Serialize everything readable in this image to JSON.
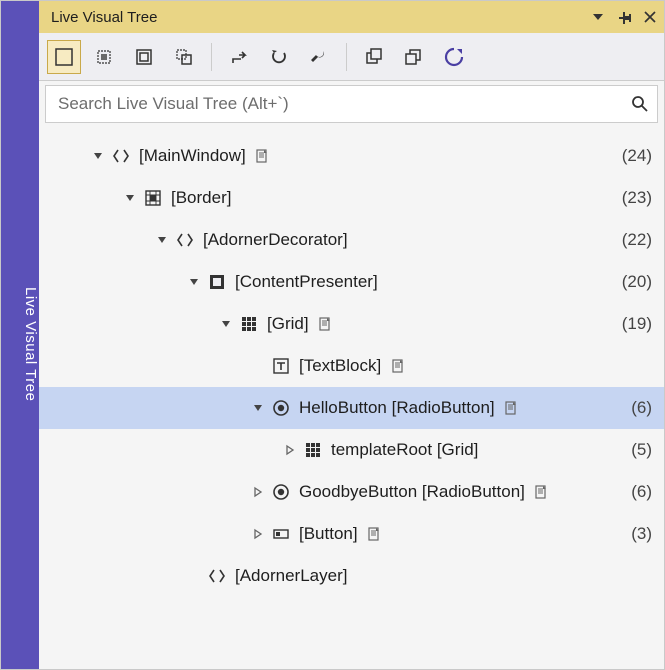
{
  "sideTab": {
    "label": "Live Visual Tree"
  },
  "header": {
    "title": "Live Visual Tree"
  },
  "toolbar": {
    "buttons": [
      {
        "name": "enable-selection",
        "active": true
      },
      {
        "name": "display-layout-adorners",
        "active": false
      },
      {
        "name": "preview-selection",
        "active": false
      },
      {
        "name": "track-focused",
        "active": false
      }
    ],
    "group2": [
      {
        "name": "go-to-live-property"
      },
      {
        "name": "undo-changes"
      },
      {
        "name": "settings"
      }
    ],
    "group3": [
      {
        "name": "collapse-all"
      },
      {
        "name": "expand-all"
      },
      {
        "name": "refresh"
      }
    ]
  },
  "search": {
    "placeholder": "Search Live Visual Tree (Alt+`)",
    "value": ""
  },
  "tree": [
    {
      "depth": 0,
      "arrow": "expanded",
      "icon": "element",
      "label": "[MainWindow]",
      "source": true,
      "count": "(24)",
      "selected": false,
      "interactable": true
    },
    {
      "depth": 1,
      "arrow": "expanded",
      "icon": "border",
      "label": "[Border]",
      "source": false,
      "count": "(23)",
      "selected": false,
      "interactable": true
    },
    {
      "depth": 2,
      "arrow": "expanded",
      "icon": "element",
      "label": "[AdornerDecorator]",
      "source": false,
      "count": "(22)",
      "selected": false,
      "interactable": true
    },
    {
      "depth": 3,
      "arrow": "expanded",
      "icon": "presenter",
      "label": "[ContentPresenter]",
      "source": false,
      "count": "(20)",
      "selected": false,
      "interactable": true
    },
    {
      "depth": 4,
      "arrow": "expanded",
      "icon": "grid",
      "label": "[Grid]",
      "source": true,
      "count": "(19)",
      "selected": false,
      "interactable": true
    },
    {
      "depth": 5,
      "arrow": "none",
      "icon": "textblock",
      "label": "[TextBlock]",
      "source": true,
      "count": "",
      "selected": false,
      "interactable": true
    },
    {
      "depth": 5,
      "arrow": "expanded",
      "icon": "radio",
      "label": "HelloButton [RadioButton]",
      "source": true,
      "count": "(6)",
      "selected": true,
      "interactable": true
    },
    {
      "depth": 6,
      "arrow": "collapsed",
      "icon": "grid",
      "label": "templateRoot [Grid]",
      "source": false,
      "count": "(5)",
      "selected": false,
      "interactable": true
    },
    {
      "depth": 5,
      "arrow": "collapsed",
      "icon": "radio",
      "label": "GoodbyeButton [RadioButton]",
      "source": true,
      "count": "(6)",
      "selected": false,
      "interactable": true
    },
    {
      "depth": 5,
      "arrow": "collapsed",
      "icon": "button",
      "label": "[Button]",
      "source": true,
      "count": "(3)",
      "selected": false,
      "interactable": true
    },
    {
      "depth": 3,
      "arrow": "none",
      "icon": "element",
      "label": "[AdornerLayer]",
      "source": false,
      "count": "",
      "selected": false,
      "interactable": true
    }
  ],
  "icons": {
    "expanded_arrow": "expanded-arrow-icon",
    "collapsed_arrow": "collapsed-arrow-icon"
  },
  "indentBase": 50,
  "indentStep": 32
}
